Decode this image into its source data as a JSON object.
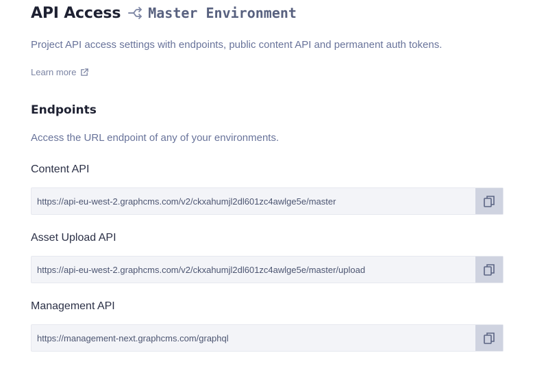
{
  "header": {
    "title": "API Access",
    "environment": "Master Environment",
    "description": "Project API access settings with endpoints, public content API and permanent auth tokens.",
    "learn_more": "Learn more"
  },
  "endpoints": {
    "title": "Endpoints",
    "description": "Access the URL endpoint of any of your environments.",
    "items": [
      {
        "label": "Content API",
        "url": "https://api-eu-west-2.graphcms.com/v2/ckxahumjl2dl601zc4awlge5e/master"
      },
      {
        "label": "Asset Upload API",
        "url": "https://api-eu-west-2.graphcms.com/v2/ckxahumjl2dl601zc4awlge5e/master/upload"
      },
      {
        "label": "Management API",
        "url": "https://management-next.graphcms.com/graphql"
      }
    ]
  },
  "icons": {
    "environment": "branch-icon",
    "learn_more": "external-link-icon",
    "copy": "copy-icon"
  },
  "colors": {
    "title": "#1e2132",
    "muted_text": "#68739a",
    "field_bg": "#f3f4f8",
    "copy_button_bg": "#cfd3e0"
  }
}
